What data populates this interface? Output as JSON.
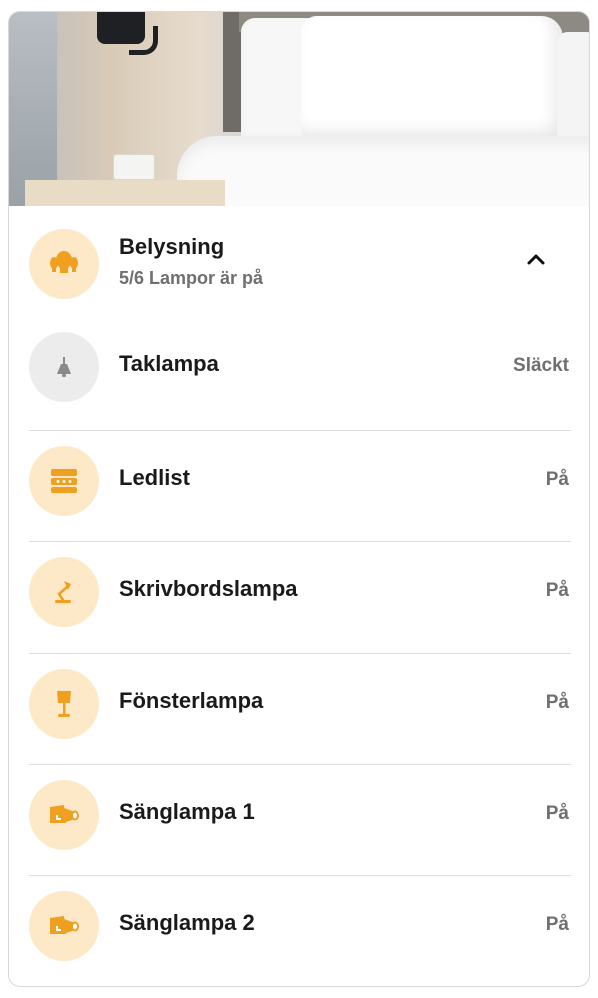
{
  "header": {
    "title": "Belysning",
    "subtitle": "5/6 Lampor är på",
    "icon": "light-bulbs-icon",
    "expanded": true
  },
  "colors": {
    "accent": "#f0a020",
    "accent_bg": "#fde8c8",
    "off_icon": "#8a8a8a",
    "off_bg": "#ececec"
  },
  "lamps": [
    {
      "name": "Taklampa",
      "state": "Släckt",
      "on": false,
      "icon": "ceiling-lamp-icon"
    },
    {
      "name": "Ledlist",
      "state": "På",
      "on": true,
      "icon": "led-strip-icon"
    },
    {
      "name": "Skrivbordslampa",
      "state": "På",
      "on": true,
      "icon": "desk-lamp-icon"
    },
    {
      "name": "Fönsterlampa",
      "state": "På",
      "on": true,
      "icon": "floor-lamp-icon"
    },
    {
      "name": "Sänglampa 1",
      "state": "På",
      "on": true,
      "icon": "spotlight-icon"
    },
    {
      "name": "Sänglampa 2",
      "state": "På",
      "on": true,
      "icon": "spotlight-icon"
    }
  ]
}
